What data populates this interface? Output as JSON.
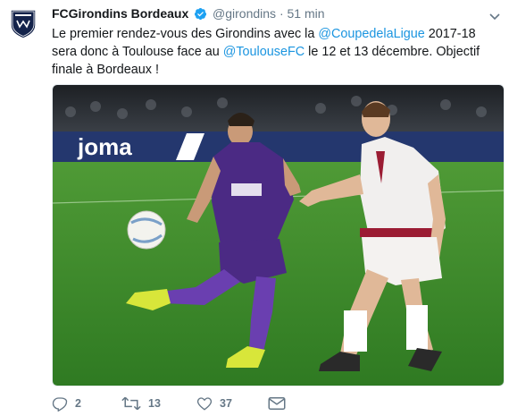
{
  "tweet": {
    "author": "FCGirondins Bordeaux",
    "handle": "@girondins",
    "separator": "·",
    "time": "51 min",
    "text_parts": {
      "p1": "Le premier rendez-vous des Girondins avec la ",
      "m1": "@CoupedelaLigue",
      "p2": " 2017-18 sera donc à Toulouse face au ",
      "m2": "@ToulouseFC",
      "p3": " le 12 et 13 décembre. Objectif finale à Bordeaux !"
    },
    "media_ad_text": "joma",
    "avatar_text": "GIRONDINS DE BORDEAUX"
  },
  "actions": {
    "reply_count": "2",
    "retweet_count": "13",
    "like_count": "37"
  },
  "colors": {
    "mention": "#1b95e0",
    "meta": "#657786",
    "verified": "#1da1f2",
    "girondins_navy": "#14234b",
    "toulouse_purple": "#4b2a84",
    "pitch_green": "#3f8f2c"
  },
  "icons": [
    "verified-badge-icon",
    "chevron-down-icon",
    "reply-icon",
    "retweet-icon",
    "like-icon",
    "message-icon"
  ]
}
